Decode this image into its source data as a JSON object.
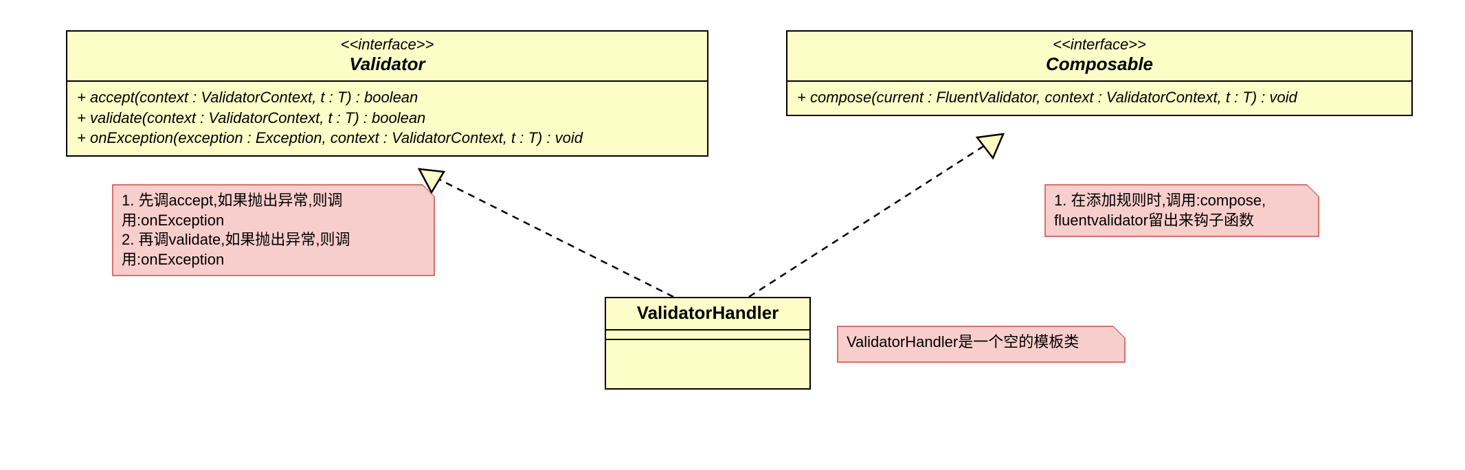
{
  "validator": {
    "stereotype": "<<interface>>",
    "name": "Validator",
    "methods": [
      "+ accept(context : ValidatorContext, t : T) : boolean",
      "+ validate(context : ValidatorContext, t : T) : boolean",
      "+ onException(exception : Exception, context : ValidatorContext, t : T) : void"
    ]
  },
  "composable": {
    "stereotype": "<<interface>>",
    "name": "Composable",
    "methods": [
      "+ compose(current : FluentValidator, context : ValidatorContext, t : T) : void"
    ]
  },
  "validatorHandler": {
    "name": "ValidatorHandler"
  },
  "notes": {
    "validatorNote": "1. 先调accept,如果抛出异常,则调用:onException\n2. 再调validate,如果抛出异常,则调用:onException",
    "composableNote": "1. 在添加规则时,调用:compose, fluentvalidator留出来钩子函数",
    "handlerNote": "ValidatorHandler是一个空的模板类"
  }
}
